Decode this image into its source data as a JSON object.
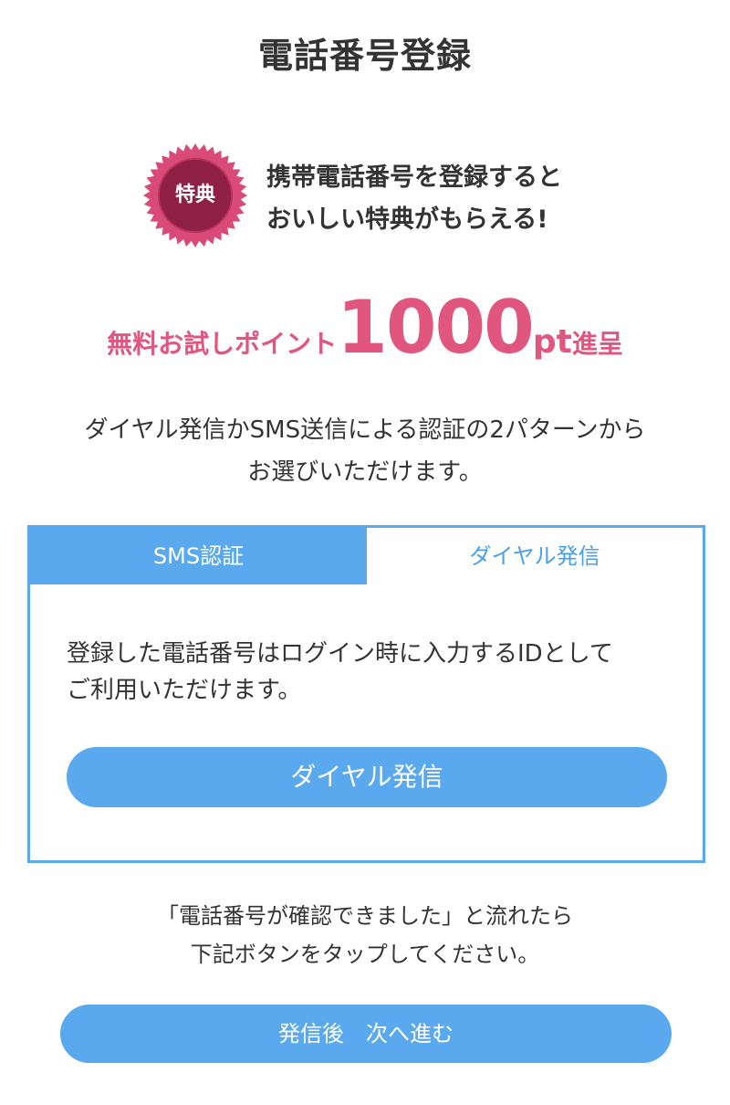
{
  "page": {
    "title": "電話番号登録"
  },
  "promo": {
    "badge_label": "特典",
    "line1": "携帯電話番号を登録すると",
    "line2": "おいしい特典がもらえる!",
    "points_prefix": "無料お試しポイント",
    "points_value": "1000",
    "points_unit": "pt",
    "points_suffix": "進呈"
  },
  "description": {
    "line1": "ダイヤル発信かSMS送信による認証の2パターンから",
    "line2": "お選びいただけます。"
  },
  "tabs": [
    {
      "label": "SMS認証",
      "active": true
    },
    {
      "label": "ダイヤル発信",
      "active": false
    }
  ],
  "panel": {
    "text_line1": "登録した電話番号はログイン時に入力するIDとして",
    "text_line2": "ご利用いただけます。",
    "dial_button_label": "ダイヤル発信"
  },
  "note": {
    "line1": "「電話番号が確認できました」と流れたら",
    "line2": "下記ボタンをタップしてください。"
  },
  "next_button_label": "発信後　次へ進む",
  "colors": {
    "accent_blue": "#5aa9ef",
    "promo_pink": "#e0567f",
    "badge_outer": "#d94a79",
    "badge_inner": "#8e1f45"
  }
}
